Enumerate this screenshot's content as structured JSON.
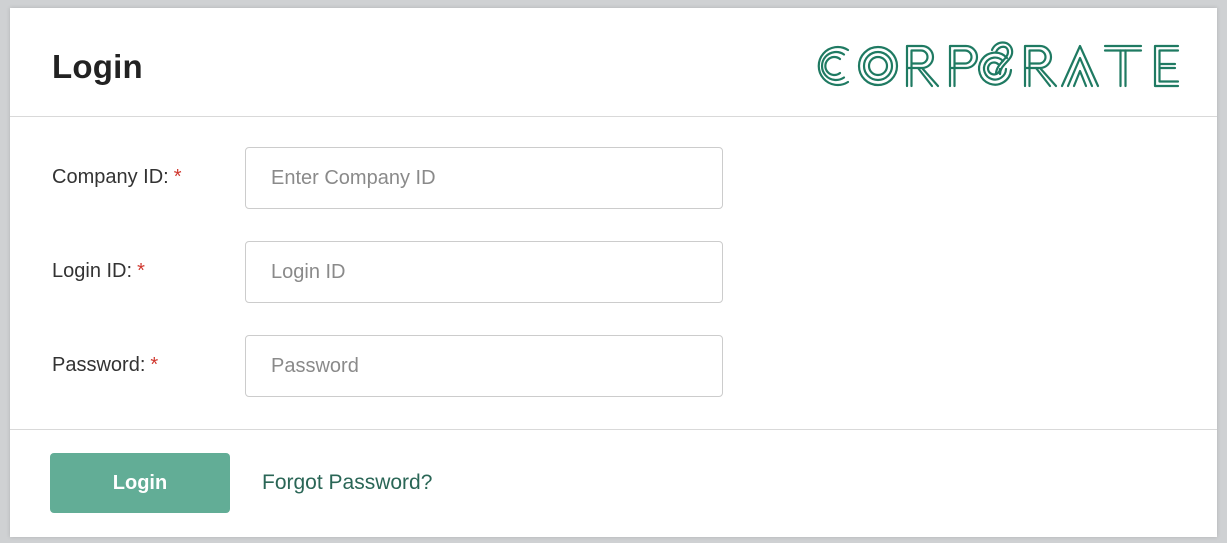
{
  "header": {
    "title": "Login",
    "brand": {
      "name": "CORPORATE",
      "color": "#1f7a62"
    }
  },
  "form": {
    "fields": [
      {
        "label": "Company ID:",
        "required_mark": "*",
        "value": "",
        "placeholder": "Enter Company ID"
      },
      {
        "label": "Login ID:",
        "required_mark": "*",
        "value": "",
        "placeholder": "Login ID"
      },
      {
        "label": "Password:",
        "required_mark": "*",
        "value": "",
        "placeholder": "Password"
      }
    ]
  },
  "footer": {
    "login_label": "Login",
    "forgot_label": "Forgot Password?"
  },
  "colors": {
    "accent": "#62ad96",
    "link": "#2a6656",
    "required": "#d0372e"
  }
}
